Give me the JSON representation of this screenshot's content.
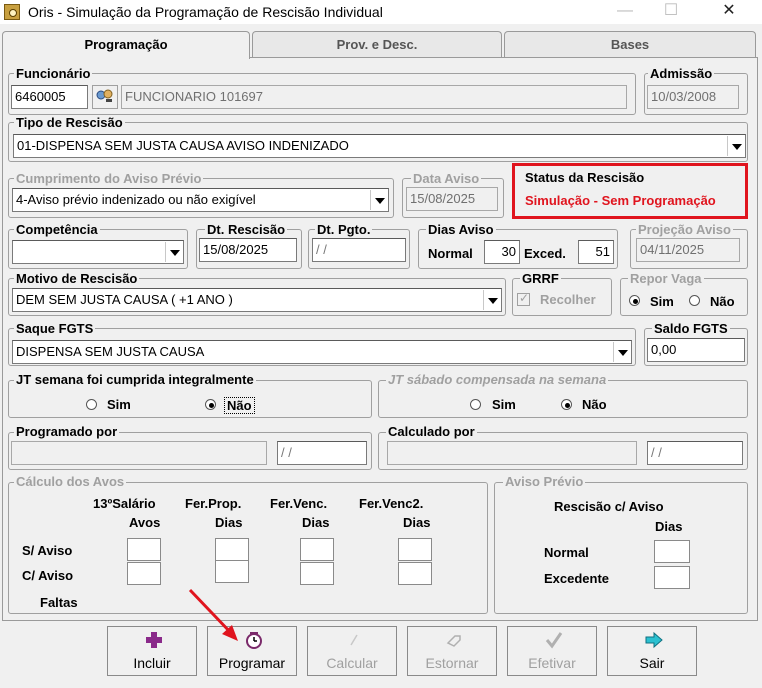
{
  "window": {
    "title": "Oris - Simulação da Programação de Rescisão Individual",
    "icon": "app-icon"
  },
  "tabs": [
    {
      "label": "Programação",
      "active": true
    },
    {
      "label": "Prov. e Desc.",
      "active": false
    },
    {
      "label": "Bases",
      "active": false
    }
  ],
  "funcionario": {
    "label": "Funcionário",
    "code": "6460005",
    "name": "FUNCIONARIO 101697",
    "lookup_icon": "people-search-icon"
  },
  "admissao": {
    "label": "Admissão",
    "value": "10/03/2008"
  },
  "tipo_rescisao": {
    "label": "Tipo de Rescisão",
    "value": "01-DISPENSA SEM JUSTA CAUSA AVISO INDENIZADO"
  },
  "cumprimento": {
    "label": "Cumprimento do Aviso Prévio",
    "value": "4-Aviso prévio indenizado ou não exigível"
  },
  "data_aviso": {
    "label": "Data Aviso",
    "value": "15/08/2025"
  },
  "status": {
    "label": "Status da Rescisão",
    "value": "Simulação - Sem Programação",
    "color": "#e0141e"
  },
  "competencia": {
    "label": "Competência",
    "value": ""
  },
  "dt_rescisao": {
    "label": "Dt. Rescisão",
    "value": "15/08/2025"
  },
  "dt_pgto": {
    "label": "Dt. Pgto.",
    "value": " / /"
  },
  "dias_aviso": {
    "label": "Dias Aviso",
    "normal_label": "Normal",
    "normal": "30",
    "exced_label": "Exced.",
    "exced": "51"
  },
  "projecao": {
    "label": "Projeção Aviso",
    "value": "04/11/2025"
  },
  "motivo": {
    "label": "Motivo de Rescisão",
    "value": "DEM SEM JUSTA CAUSA ( +1 ANO )"
  },
  "grrf": {
    "label": "GRRF",
    "check_label": "Recolher"
  },
  "repor_vaga": {
    "label": "Repor Vaga",
    "sim": "Sim",
    "nao": "Não"
  },
  "saque": {
    "label": "Saque FGTS",
    "value": "DISPENSA SEM JUSTA CAUSA"
  },
  "saldo": {
    "label": "Saldo FGTS",
    "value": "0,00"
  },
  "jt_semana": {
    "label": "JT semana foi cumprida integralmente",
    "sim": "Sim",
    "nao": "Não"
  },
  "jt_sabado": {
    "label": "JT sábado compensada na semana",
    "sim": "Sim",
    "nao": "Não"
  },
  "programado": {
    "label": "Programado por",
    "date": " / /"
  },
  "calculado": {
    "label": "Calculado por",
    "date": " / /"
  },
  "calculo": {
    "label": "Cálculo dos Avos",
    "col1": [
      "13ºSalário",
      "Avos"
    ],
    "col2": [
      "Fer.Prop.",
      "Dias"
    ],
    "col3": [
      "Fer.Venc.",
      "Dias"
    ],
    "col4": [
      "Fer.Venc2.",
      "Dias"
    ],
    "rows": [
      "S/ Aviso",
      "C/ Aviso",
      "Faltas"
    ]
  },
  "aviso_previo": {
    "label": "Aviso Prévio",
    "head1": "Rescisão c/ Aviso",
    "head2": "Dias",
    "normal": "Normal",
    "excedente": "Excedente"
  },
  "toolbar": [
    {
      "label": "Incluir",
      "icon": "plus-icon",
      "enabled": true
    },
    {
      "label": "Programar",
      "icon": "clock-icon",
      "enabled": true
    },
    {
      "label": "Calcular",
      "icon": "calculator-icon",
      "enabled": false
    },
    {
      "label": "Estornar",
      "icon": "undo-icon",
      "enabled": false
    },
    {
      "label": "Efetivar",
      "icon": "checkmark-icon",
      "enabled": false
    },
    {
      "label": "Sair",
      "icon": "exit-arrow-icon",
      "enabled": true
    }
  ],
  "annotation_color": "#e0141e"
}
